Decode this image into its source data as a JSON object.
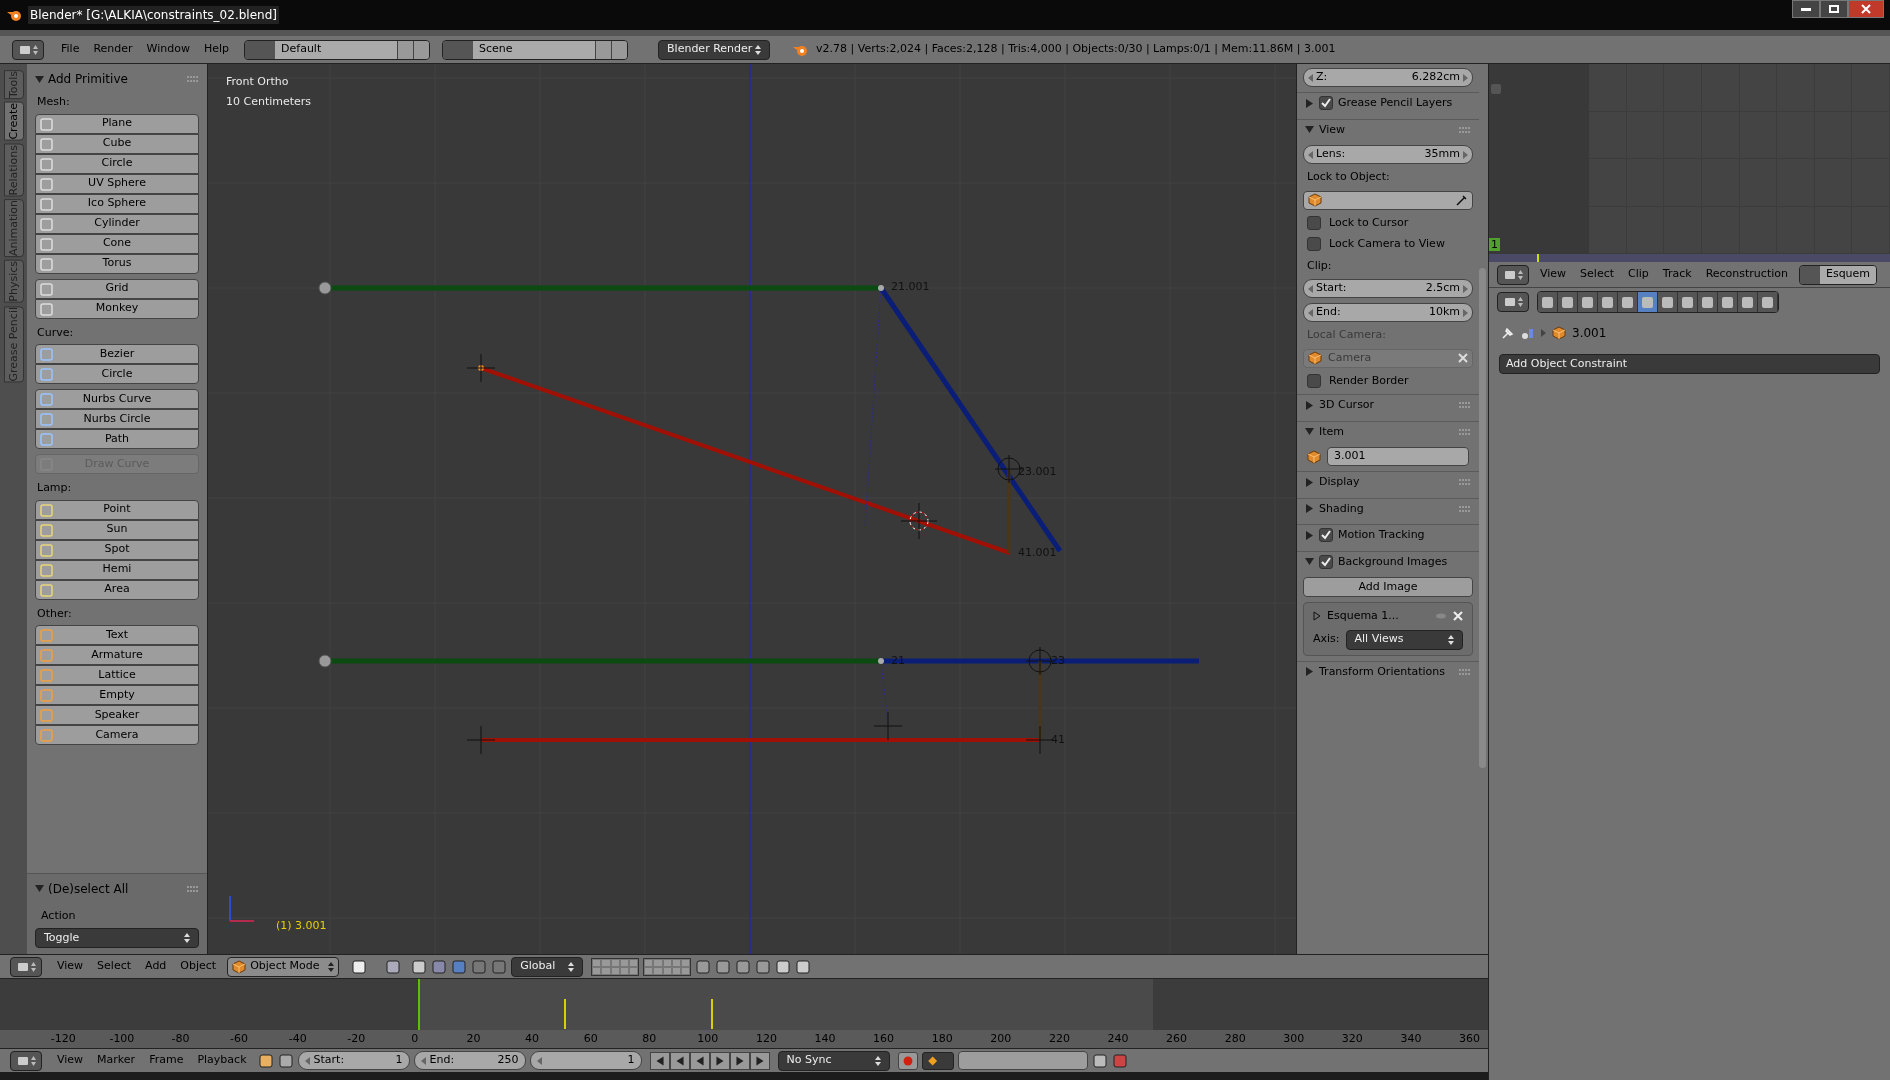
{
  "window": {
    "title": "Blender* [G:\\ALKIA\\constraints_02.blend]"
  },
  "info_header": {
    "menus": [
      "File",
      "Render",
      "Window",
      "Help"
    ],
    "screen_layout": "Default",
    "scene": "Scene",
    "render_engine": "Blender Render",
    "stats": "v2.78 | Verts:2,024 | Faces:2,128 | Tris:4,000 | Objects:0/30 | Lamps:0/1 | Mem:11.86M | 3.001"
  },
  "tool_shelf": {
    "tabs": [
      {
        "label": "Tools",
        "selected": false
      },
      {
        "label": "Create",
        "selected": true
      },
      {
        "label": "Relations",
        "selected": false
      },
      {
        "label": "Animation",
        "selected": false
      },
      {
        "label": "Physics",
        "selected": false
      },
      {
        "label": "Grease Pencil",
        "selected": false
      }
    ],
    "panel_title": "Add Primitive",
    "groups": [
      {
        "label": "Mesh:",
        "blocks": [
          [
            {
              "label": "Plane",
              "disabled": false
            },
            {
              "label": "Cube",
              "disabled": false
            },
            {
              "label": "Circle",
              "disabled": false
            },
            {
              "label": "UV Sphere",
              "disabled": false
            },
            {
              "label": "Ico Sphere",
              "disabled": false
            },
            {
              "label": "Cylinder",
              "disabled": false
            },
            {
              "label": "Cone",
              "disabled": false
            },
            {
              "label": "Torus",
              "disabled": false
            }
          ],
          [
            {
              "label": "Grid",
              "disabled": false
            },
            {
              "label": "Monkey",
              "disabled": false
            }
          ]
        ]
      },
      {
        "label": "Curve:",
        "blocks": [
          [
            {
              "label": "Bezier",
              "disabled": false
            },
            {
              "label": "Circle",
              "disabled": false
            }
          ],
          [
            {
              "label": "Nurbs Curve",
              "disabled": false
            },
            {
              "label": "Nurbs Circle",
              "disabled": false
            },
            {
              "label": "Path",
              "disabled": false
            }
          ],
          [
            {
              "label": "Draw Curve",
              "disabled": true
            }
          ]
        ]
      },
      {
        "label": "Lamp:",
        "blocks": [
          [
            {
              "label": "Point",
              "disabled": false
            },
            {
              "label": "Sun",
              "disabled": false
            },
            {
              "label": "Spot",
              "disabled": false
            },
            {
              "label": "Hemi",
              "disabled": false
            },
            {
              "label": "Area",
              "disabled": false
            }
          ]
        ]
      },
      {
        "label": "Other:",
        "blocks": [
          [
            {
              "label": "Text",
              "disabled": false
            },
            {
              "label": "Armature",
              "disabled": false
            },
            {
              "label": "Lattice",
              "disabled": false
            },
            {
              "label": "Empty",
              "disabled": false
            },
            {
              "label": "Speaker",
              "disabled": false
            },
            {
              "label": "Camera",
              "disabled": false
            }
          ]
        ]
      }
    ],
    "operator": {
      "title": "(De)select All",
      "field_label": "Action",
      "value": "Toggle"
    }
  },
  "viewport": {
    "view_name": "Front Ortho",
    "scale": "10 Centimeters",
    "labels": [
      "21.001",
      "23.001",
      "41.001",
      "21",
      "23",
      "41"
    ],
    "active_object": "(1) 3.001"
  },
  "n_panel": [
    {
      "kind": "field",
      "label": "Z:",
      "value": "6.282cm"
    },
    {
      "kind": "check_panel",
      "title": "Grease Pencil Layers",
      "expanded": false,
      "checked": true
    },
    {
      "kind": "panel",
      "title": "View",
      "expanded": true
    },
    {
      "kind": "field",
      "label": "Lens:",
      "value": "35mm"
    },
    {
      "kind": "label",
      "text": "Lock to Object:",
      "disabled": false
    },
    {
      "kind": "object_field",
      "disabled": false
    },
    {
      "kind": "checkbox",
      "label": "Lock to Cursor",
      "checked": false
    },
    {
      "kind": "checkbox",
      "label": "Lock Camera to View",
      "checked": false
    },
    {
      "kind": "label",
      "text": "Clip:",
      "disabled": false
    },
    {
      "kind": "field",
      "label": "Start:",
      "value": "2.5cm"
    },
    {
      "kind": "field",
      "label": "End:",
      "value": "10km"
    },
    {
      "kind": "label",
      "text": "Local Camera:",
      "disabled": true
    },
    {
      "kind": "object_field",
      "value": "Camera",
      "disabled": true
    },
    {
      "kind": "checkbox",
      "label": "Render Border",
      "checked": false
    },
    {
      "kind": "panel",
      "title": "3D Cursor",
      "expanded": false
    },
    {
      "kind": "panel",
      "title": "Item",
      "expanded": true
    },
    {
      "kind": "name_field",
      "value": "3.001"
    },
    {
      "kind": "panel",
      "title": "Display",
      "expanded": false
    },
    {
      "kind": "panel",
      "title": "Shading",
      "expanded": false
    },
    {
      "kind": "check_panel",
      "title": "Motion Tracking",
      "expanded": false,
      "checked": true
    },
    {
      "kind": "check_panel",
      "title": "Background Images",
      "expanded": true,
      "checked": true
    },
    {
      "kind": "button",
      "label": "Add Image"
    },
    {
      "kind": "bg_image",
      "name": "Esquema 1...",
      "axis_label": "Axis:",
      "axis": "All Views"
    },
    {
      "kind": "panel",
      "title": "Transform Orientations",
      "expanded": false
    }
  ],
  "clip_editor": {
    "frame": "1",
    "menus": [
      "View",
      "Select",
      "Clip",
      "Track",
      "Reconstruction"
    ],
    "clip_name": "Esquem"
  },
  "properties": {
    "tabs": [
      {
        "selected": false
      },
      {
        "selected": false
      },
      {
        "selected": false
      },
      {
        "selected": false
      },
      {
        "selected": false
      },
      {
        "selected": true
      },
      {
        "selected": false
      },
      {
        "selected": false
      },
      {
        "selected": false
      },
      {
        "selected": false
      },
      {
        "selected": false
      },
      {
        "selected": false
      }
    ],
    "context": "3.001",
    "add_button": "Add Object Constraint"
  },
  "view3d_header": {
    "menus": [
      "View",
      "Select",
      "Add",
      "Object"
    ],
    "mode": "Object Mode",
    "orientation": "Global"
  },
  "timeline": {
    "ruler": [
      "-120",
      "-100",
      "-80",
      "-60",
      "-40",
      "-20",
      "0",
      "20",
      "40",
      "60",
      "80",
      "100",
      "120",
      "140",
      "160",
      "180",
      "200",
      "220",
      "240",
      "260",
      "280",
      "300",
      "320",
      "340",
      "360"
    ]
  },
  "timeline_header": {
    "menus": [
      "View",
      "Marker",
      "Frame",
      "Playback"
    ],
    "start_label": "Start:",
    "start": "1",
    "end_label": "End:",
    "end": "250",
    "current": "1",
    "sync": "No Sync"
  }
}
